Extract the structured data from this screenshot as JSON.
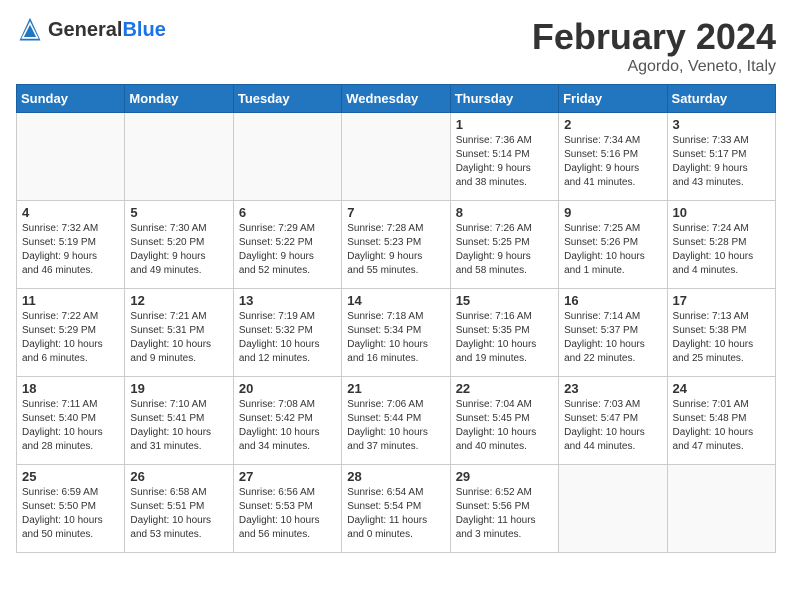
{
  "header": {
    "logo_general": "General",
    "logo_blue": "Blue",
    "title": "February 2024",
    "subtitle": "Agordo, Veneto, Italy"
  },
  "weekdays": [
    "Sunday",
    "Monday",
    "Tuesday",
    "Wednesday",
    "Thursday",
    "Friday",
    "Saturday"
  ],
  "weeks": [
    [
      {
        "day": "",
        "info": ""
      },
      {
        "day": "",
        "info": ""
      },
      {
        "day": "",
        "info": ""
      },
      {
        "day": "",
        "info": ""
      },
      {
        "day": "1",
        "info": "Sunrise: 7:36 AM\nSunset: 5:14 PM\nDaylight: 9 hours\nand 38 minutes."
      },
      {
        "day": "2",
        "info": "Sunrise: 7:34 AM\nSunset: 5:16 PM\nDaylight: 9 hours\nand 41 minutes."
      },
      {
        "day": "3",
        "info": "Sunrise: 7:33 AM\nSunset: 5:17 PM\nDaylight: 9 hours\nand 43 minutes."
      }
    ],
    [
      {
        "day": "4",
        "info": "Sunrise: 7:32 AM\nSunset: 5:19 PM\nDaylight: 9 hours\nand 46 minutes."
      },
      {
        "day": "5",
        "info": "Sunrise: 7:30 AM\nSunset: 5:20 PM\nDaylight: 9 hours\nand 49 minutes."
      },
      {
        "day": "6",
        "info": "Sunrise: 7:29 AM\nSunset: 5:22 PM\nDaylight: 9 hours\nand 52 minutes."
      },
      {
        "day": "7",
        "info": "Sunrise: 7:28 AM\nSunset: 5:23 PM\nDaylight: 9 hours\nand 55 minutes."
      },
      {
        "day": "8",
        "info": "Sunrise: 7:26 AM\nSunset: 5:25 PM\nDaylight: 9 hours\nand 58 minutes."
      },
      {
        "day": "9",
        "info": "Sunrise: 7:25 AM\nSunset: 5:26 PM\nDaylight: 10 hours\nand 1 minute."
      },
      {
        "day": "10",
        "info": "Sunrise: 7:24 AM\nSunset: 5:28 PM\nDaylight: 10 hours\nand 4 minutes."
      }
    ],
    [
      {
        "day": "11",
        "info": "Sunrise: 7:22 AM\nSunset: 5:29 PM\nDaylight: 10 hours\nand 6 minutes."
      },
      {
        "day": "12",
        "info": "Sunrise: 7:21 AM\nSunset: 5:31 PM\nDaylight: 10 hours\nand 9 minutes."
      },
      {
        "day": "13",
        "info": "Sunrise: 7:19 AM\nSunset: 5:32 PM\nDaylight: 10 hours\nand 12 minutes."
      },
      {
        "day": "14",
        "info": "Sunrise: 7:18 AM\nSunset: 5:34 PM\nDaylight: 10 hours\nand 16 minutes."
      },
      {
        "day": "15",
        "info": "Sunrise: 7:16 AM\nSunset: 5:35 PM\nDaylight: 10 hours\nand 19 minutes."
      },
      {
        "day": "16",
        "info": "Sunrise: 7:14 AM\nSunset: 5:37 PM\nDaylight: 10 hours\nand 22 minutes."
      },
      {
        "day": "17",
        "info": "Sunrise: 7:13 AM\nSunset: 5:38 PM\nDaylight: 10 hours\nand 25 minutes."
      }
    ],
    [
      {
        "day": "18",
        "info": "Sunrise: 7:11 AM\nSunset: 5:40 PM\nDaylight: 10 hours\nand 28 minutes."
      },
      {
        "day": "19",
        "info": "Sunrise: 7:10 AM\nSunset: 5:41 PM\nDaylight: 10 hours\nand 31 minutes."
      },
      {
        "day": "20",
        "info": "Sunrise: 7:08 AM\nSunset: 5:42 PM\nDaylight: 10 hours\nand 34 minutes."
      },
      {
        "day": "21",
        "info": "Sunrise: 7:06 AM\nSunset: 5:44 PM\nDaylight: 10 hours\nand 37 minutes."
      },
      {
        "day": "22",
        "info": "Sunrise: 7:04 AM\nSunset: 5:45 PM\nDaylight: 10 hours\nand 40 minutes."
      },
      {
        "day": "23",
        "info": "Sunrise: 7:03 AM\nSunset: 5:47 PM\nDaylight: 10 hours\nand 44 minutes."
      },
      {
        "day": "24",
        "info": "Sunrise: 7:01 AM\nSunset: 5:48 PM\nDaylight: 10 hours\nand 47 minutes."
      }
    ],
    [
      {
        "day": "25",
        "info": "Sunrise: 6:59 AM\nSunset: 5:50 PM\nDaylight: 10 hours\nand 50 minutes."
      },
      {
        "day": "26",
        "info": "Sunrise: 6:58 AM\nSunset: 5:51 PM\nDaylight: 10 hours\nand 53 minutes."
      },
      {
        "day": "27",
        "info": "Sunrise: 6:56 AM\nSunset: 5:53 PM\nDaylight: 10 hours\nand 56 minutes."
      },
      {
        "day": "28",
        "info": "Sunrise: 6:54 AM\nSunset: 5:54 PM\nDaylight: 11 hours\nand 0 minutes."
      },
      {
        "day": "29",
        "info": "Sunrise: 6:52 AM\nSunset: 5:56 PM\nDaylight: 11 hours\nand 3 minutes."
      },
      {
        "day": "",
        "info": ""
      },
      {
        "day": "",
        "info": ""
      }
    ]
  ]
}
